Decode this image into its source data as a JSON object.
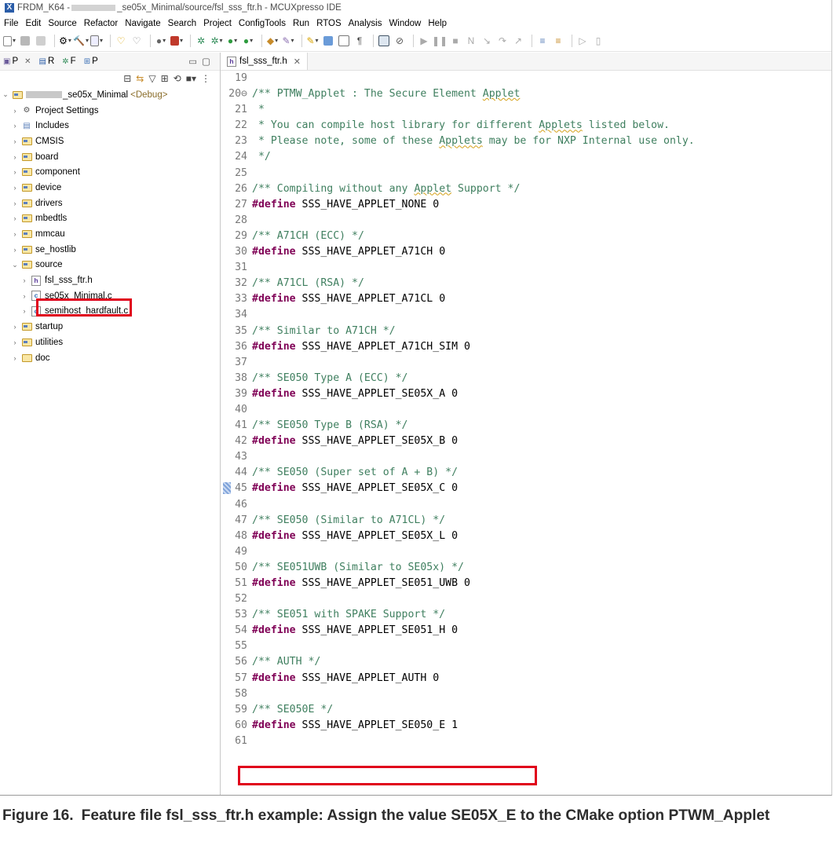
{
  "window": {
    "title_prefix": "FRDM_K64 -",
    "title_suffix": "_se05x_Minimal/source/fsl_sss_ftr.h - MCUXpresso IDE"
  },
  "menu": [
    "File",
    "Edit",
    "Source",
    "Refactor",
    "Navigate",
    "Search",
    "Project",
    "ConfigTools",
    "Run",
    "RTOS",
    "Analysis",
    "Window",
    "Help"
  ],
  "left_tabs": [
    {
      "label": "P",
      "icon": "project-explorer-icon"
    },
    {
      "label": "R",
      "icon": "registers-icon"
    },
    {
      "label": "F",
      "icon": "faults-icon"
    },
    {
      "label": "P",
      "icon": "peripherals-icon"
    }
  ],
  "tree": {
    "project": {
      "name": "_se05x_Minimal",
      "tag": "<Debug>"
    },
    "items": [
      {
        "label": "Project Settings",
        "icon": "settings-icon",
        "indent": 1,
        "expanded": false
      },
      {
        "label": "Includes",
        "icon": "includes-icon",
        "indent": 1,
        "expanded": false
      },
      {
        "label": "CMSIS",
        "icon": "source-folder-icon",
        "indent": 1,
        "expanded": false
      },
      {
        "label": "board",
        "icon": "source-folder-icon",
        "indent": 1,
        "expanded": false
      },
      {
        "label": "component",
        "icon": "source-folder-icon",
        "indent": 1,
        "expanded": false
      },
      {
        "label": "device",
        "icon": "source-folder-icon",
        "indent": 1,
        "expanded": false
      },
      {
        "label": "drivers",
        "icon": "source-folder-icon",
        "indent": 1,
        "expanded": false
      },
      {
        "label": "mbedtls",
        "icon": "source-folder-icon",
        "indent": 1,
        "expanded": false
      },
      {
        "label": "mmcau",
        "icon": "source-folder-icon",
        "indent": 1,
        "expanded": false
      },
      {
        "label": "se_hostlib",
        "icon": "source-folder-icon",
        "indent": 1,
        "expanded": false
      },
      {
        "label": "source",
        "icon": "source-folder-icon",
        "indent": 1,
        "expanded": true
      },
      {
        "label": "fsl_sss_ftr.h",
        "icon": "header-file-icon",
        "indent": 2,
        "expanded": false,
        "highlight": true
      },
      {
        "label": "se05x_Minimal.c",
        "icon": "c-file-icon",
        "indent": 2,
        "expanded": false
      },
      {
        "label": "semihost_hardfault.c",
        "icon": "c-file-icon",
        "indent": 2,
        "expanded": false
      },
      {
        "label": "startup",
        "icon": "source-folder-icon",
        "indent": 1,
        "expanded": false
      },
      {
        "label": "utilities",
        "icon": "source-folder-icon",
        "indent": 1,
        "expanded": false
      },
      {
        "label": "doc",
        "icon": "folder-icon",
        "indent": 1,
        "expanded": false
      }
    ]
  },
  "editor": {
    "tab_label": "fsl_sss_ftr.h",
    "lines": [
      {
        "n": "19",
        "parts": []
      },
      {
        "n": "20⊖",
        "parts": [
          {
            "c": "cm",
            "t": "/** PTMW_Applet : The Secure Element "
          },
          {
            "c": "cm sq-u",
            "t": "Applet"
          }
        ]
      },
      {
        "n": "21",
        "parts": [
          {
            "c": "cm",
            "t": " *"
          }
        ]
      },
      {
        "n": "22",
        "parts": [
          {
            "c": "cm",
            "t": " * You can compile host library for different "
          },
          {
            "c": "cm sq-u",
            "t": "Applets"
          },
          {
            "c": "cm",
            "t": " listed below."
          }
        ]
      },
      {
        "n": "23",
        "parts": [
          {
            "c": "cm",
            "t": " * Please note, some of these "
          },
          {
            "c": "cm sq-u",
            "t": "Applets"
          },
          {
            "c": "cm",
            "t": " may be for NXP Internal use only."
          }
        ]
      },
      {
        "n": "24",
        "parts": [
          {
            "c": "cm",
            "t": " */"
          }
        ]
      },
      {
        "n": "25",
        "parts": []
      },
      {
        "n": "26",
        "parts": [
          {
            "c": "cm",
            "t": "/** Compiling without any "
          },
          {
            "c": "cm sq-u",
            "t": "Applet"
          },
          {
            "c": "cm",
            "t": " Support */"
          }
        ]
      },
      {
        "n": "27",
        "parts": [
          {
            "c": "kw",
            "t": "#define"
          },
          {
            "c": "",
            "t": " SSS_HAVE_APPLET_NONE 0"
          }
        ]
      },
      {
        "n": "28",
        "parts": []
      },
      {
        "n": "29",
        "parts": [
          {
            "c": "cm",
            "t": "/** A71CH (ECC) */"
          }
        ]
      },
      {
        "n": "30",
        "parts": [
          {
            "c": "kw",
            "t": "#define"
          },
          {
            "c": "",
            "t": " SSS_HAVE_APPLET_A71CH 0"
          }
        ]
      },
      {
        "n": "31",
        "parts": []
      },
      {
        "n": "32",
        "parts": [
          {
            "c": "cm",
            "t": "/** A71CL (RSA) */"
          }
        ]
      },
      {
        "n": "33",
        "parts": [
          {
            "c": "kw",
            "t": "#define"
          },
          {
            "c": "",
            "t": " SSS_HAVE_APPLET_A71CL 0"
          }
        ]
      },
      {
        "n": "34",
        "parts": []
      },
      {
        "n": "35",
        "parts": [
          {
            "c": "cm",
            "t": "/** Similar to A71CH */"
          }
        ]
      },
      {
        "n": "36",
        "parts": [
          {
            "c": "kw",
            "t": "#define"
          },
          {
            "c": "",
            "t": " SSS_HAVE_APPLET_A71CH_SIM 0"
          }
        ]
      },
      {
        "n": "37",
        "parts": []
      },
      {
        "n": "38",
        "parts": [
          {
            "c": "cm",
            "t": "/** SE050 Type A (ECC) */"
          }
        ]
      },
      {
        "n": "39",
        "parts": [
          {
            "c": "kw",
            "t": "#define"
          },
          {
            "c": "",
            "t": " SSS_HAVE_APPLET_SE05X_A 0"
          }
        ]
      },
      {
        "n": "40",
        "parts": []
      },
      {
        "n": "41",
        "parts": [
          {
            "c": "cm",
            "t": "/** SE050 Type B (RSA) */"
          }
        ]
      },
      {
        "n": "42",
        "parts": [
          {
            "c": "kw",
            "t": "#define"
          },
          {
            "c": "",
            "t": " SSS_HAVE_APPLET_SE05X_B 0"
          }
        ]
      },
      {
        "n": "43",
        "parts": []
      },
      {
        "n": "44",
        "parts": [
          {
            "c": "cm",
            "t": "/** SE050 (Super set of A + B) */"
          }
        ]
      },
      {
        "n": "45",
        "parts": [
          {
            "c": "kw",
            "t": "#define"
          },
          {
            "c": "",
            "t": " SSS_HAVE_APPLET_SE05X_C 0"
          }
        ],
        "overview_marker": true
      },
      {
        "n": "46",
        "parts": []
      },
      {
        "n": "47",
        "parts": [
          {
            "c": "cm",
            "t": "/** SE050 (Similar to A71CL) */"
          }
        ]
      },
      {
        "n": "48",
        "parts": [
          {
            "c": "kw",
            "t": "#define"
          },
          {
            "c": "",
            "t": " SSS_HAVE_APPLET_SE05X_L 0"
          }
        ]
      },
      {
        "n": "49",
        "parts": []
      },
      {
        "n": "50",
        "parts": [
          {
            "c": "cm",
            "t": "/** SE051UWB (Similar to SE05x) */"
          }
        ]
      },
      {
        "n": "51",
        "parts": [
          {
            "c": "kw",
            "t": "#define"
          },
          {
            "c": "",
            "t": " SSS_HAVE_APPLET_SE051_UWB 0"
          }
        ]
      },
      {
        "n": "52",
        "parts": []
      },
      {
        "n": "53",
        "parts": [
          {
            "c": "cm",
            "t": "/** SE051 with SPAKE Support */"
          }
        ]
      },
      {
        "n": "54",
        "parts": [
          {
            "c": "kw",
            "t": "#define"
          },
          {
            "c": "",
            "t": " SSS_HAVE_APPLET_SE051_H 0"
          }
        ]
      },
      {
        "n": "55",
        "parts": []
      },
      {
        "n": "56",
        "parts": [
          {
            "c": "cm",
            "t": "/** AUTH */"
          }
        ]
      },
      {
        "n": "57",
        "parts": [
          {
            "c": "kw",
            "t": "#define"
          },
          {
            "c": "",
            "t": " SSS_HAVE_APPLET_AUTH 0"
          }
        ]
      },
      {
        "n": "58",
        "parts": []
      },
      {
        "n": "59",
        "parts": [
          {
            "c": "cm",
            "t": "/** SE050E */"
          }
        ]
      },
      {
        "n": "60",
        "parts": [
          {
            "c": "kw",
            "t": "#define"
          },
          {
            "c": "",
            "t": " SSS_HAVE_APPLET_SE050_E 1"
          }
        ],
        "highlight": true
      },
      {
        "n": "61",
        "parts": []
      }
    ]
  },
  "caption": {
    "label": "Figure 16.",
    "text": "Feature file fsl_sss_ftr.h example: Assign the value SE05X_E to the CMake option PTWM_Applet"
  },
  "colors": {
    "highlight_box": "#e0001b",
    "comment": "#3f7f5f",
    "keyword": "#7f0055"
  }
}
